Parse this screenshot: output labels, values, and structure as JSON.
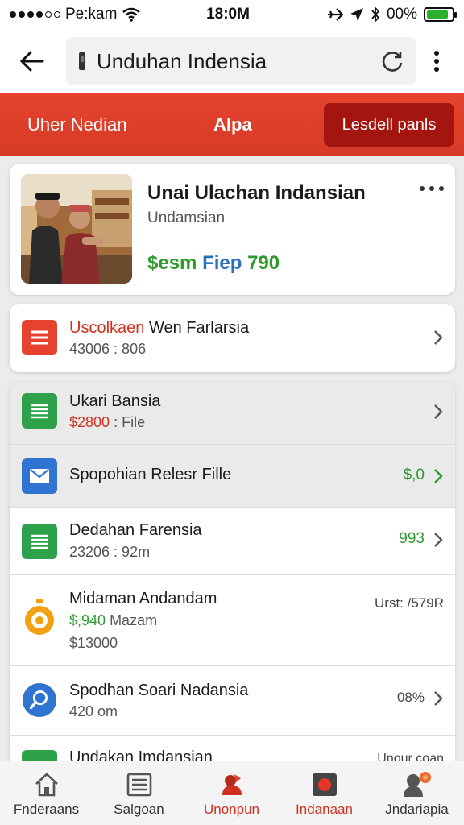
{
  "status_bar": {
    "carrier": "Pe:kam",
    "time": "18:0M",
    "battery_text": "00%",
    "battery_level": 0.85
  },
  "top_bar": {
    "url_text": "Unduhan Indensia"
  },
  "tabs": {
    "tab1": "Uher Nedian",
    "tab2": "Alpa",
    "tab3": "Lesdell panls"
  },
  "product": {
    "title": "Unai Ulachan Indansian",
    "subtitle": "Undamsian",
    "price_green": "$esm",
    "price_blue": "Fiep",
    "price_green2": "790"
  },
  "single_item": {
    "title_red": "Uscolkaen",
    "title_rest": "Wen Farlarsia",
    "subtitle": "43006 : 806"
  },
  "list": [
    {
      "title": "Ukari Bansia",
      "sub_red": "$2800",
      "sub_rest": ": File",
      "icon": "document-icon"
    },
    {
      "title": "Spopohian Relesr Fille",
      "value": "$,0",
      "icon": "mail-icon"
    },
    {
      "title": "Dedahan Farensia",
      "sub": "23206 : 92m",
      "value": "993",
      "icon": "document-icon"
    },
    {
      "title": "Midaman Andandam",
      "sub_green": "$,940",
      "sub_rest": "Mazam",
      "sub2": "$13000",
      "value": "Urst: /579R",
      "icon": "timer-icon"
    },
    {
      "title": "Spodhan Soari Nadansia",
      "sub": "420 om",
      "value": "08%",
      "icon": "search-icon"
    },
    {
      "title": "Undakan Imdansian",
      "value": "Unour coan",
      "icon": "document-icon"
    }
  ],
  "bottom_nav": [
    {
      "label": "Fnderaans",
      "icon": "home-icon"
    },
    {
      "label": "Salgoan",
      "icon": "list-icon"
    },
    {
      "label": "Unonpun",
      "icon": "profile-icon",
      "active": true
    },
    {
      "label": "Indanaan",
      "icon": "record-icon",
      "active": true
    },
    {
      "label": "Jndariapia",
      "icon": "user-icon"
    }
  ],
  "colors": {
    "accent_red": "#e5432f",
    "dark_red": "#a5150f",
    "green": "#2e9a2e",
    "blue": "#2a6fc0"
  }
}
